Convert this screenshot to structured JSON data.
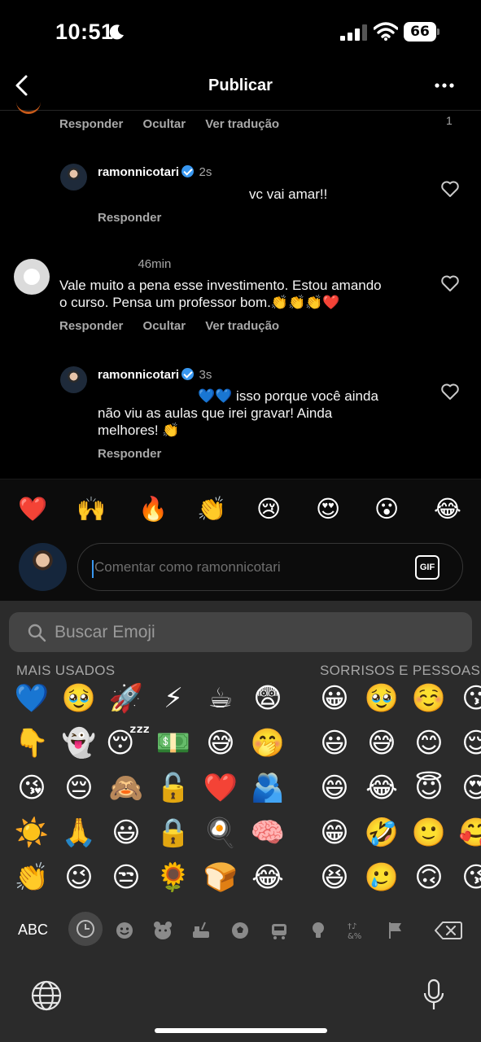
{
  "status_bar": {
    "time": "10:51",
    "battery": "66"
  },
  "header": {
    "title": "Publicar"
  },
  "comments": [
    {
      "actions": {
        "reply": "Responder",
        "hide": "Ocultar",
        "translate": "Ver tradução"
      },
      "like_count": "1"
    },
    {
      "username": "ramonnicotari",
      "time": "2s",
      "text": "vc vai amar!!",
      "actions": {
        "reply": "Responder"
      }
    },
    {
      "time": "46min",
      "text_line1": "Vale muito a pena esse investimento. Estou amando",
      "text_line2": "o curso. Pensa um professor bom.👏👏👏❤️",
      "actions": {
        "reply": "Responder",
        "hide": "Ocultar",
        "translate": "Ver tradução"
      }
    },
    {
      "username": "ramonnicotari",
      "time": "3s",
      "text_line1": "💙💙 isso porque você ainda",
      "text_line2": "não viu as aulas que irei gravar! Ainda",
      "text_line3": "melhores! 👏",
      "actions": {
        "reply": "Responder"
      }
    }
  ],
  "quick_reactions": [
    "❤️",
    "🙌",
    "🔥",
    "👏",
    "😢",
    "😍",
    "😮",
    "😂"
  ],
  "composer": {
    "placeholder": "Comentar como ramonnicotari",
    "gif_label": "GIF"
  },
  "emoji_keyboard": {
    "search_placeholder": "Buscar Emoji",
    "sections": {
      "frequent": "MAIS USADOS",
      "smileys": "SORRISOS E PESSOAS"
    },
    "frequent_rows": [
      [
        "💙",
        "🥹",
        "🚀",
        "⚡",
        "☕",
        "😨"
      ],
      [
        "👇",
        "👻",
        "😴",
        "💵",
        "😅",
        "🤭"
      ],
      [
        "😘",
        "😔",
        "🙈",
        "🔓",
        "❤️",
        "🫂"
      ],
      [
        "☀️",
        "🙏",
        "😃",
        "🔒",
        "🍳",
        "🧠"
      ],
      [
        "👏",
        "😉",
        "😒",
        "🌻",
        "🍞",
        "😂"
      ]
    ],
    "smileys_rows": [
      [
        "😀",
        "🥹",
        "☺️",
        "😗"
      ],
      [
        "😃",
        "😅",
        "😊",
        "😌"
      ],
      [
        "😄",
        "😂",
        "😇",
        "😍"
      ],
      [
        "😁",
        "🤣",
        "🙂",
        "🥰"
      ],
      [
        "😆",
        "🥲",
        "🙃",
        "😘"
      ]
    ],
    "abc_label": "ABC",
    "categories": [
      "recent-icon",
      "smiley-icon",
      "animal-icon",
      "food-icon",
      "ball-icon",
      "travel-icon",
      "lightbulb-icon",
      "symbols-icon",
      "flag-icon"
    ]
  }
}
